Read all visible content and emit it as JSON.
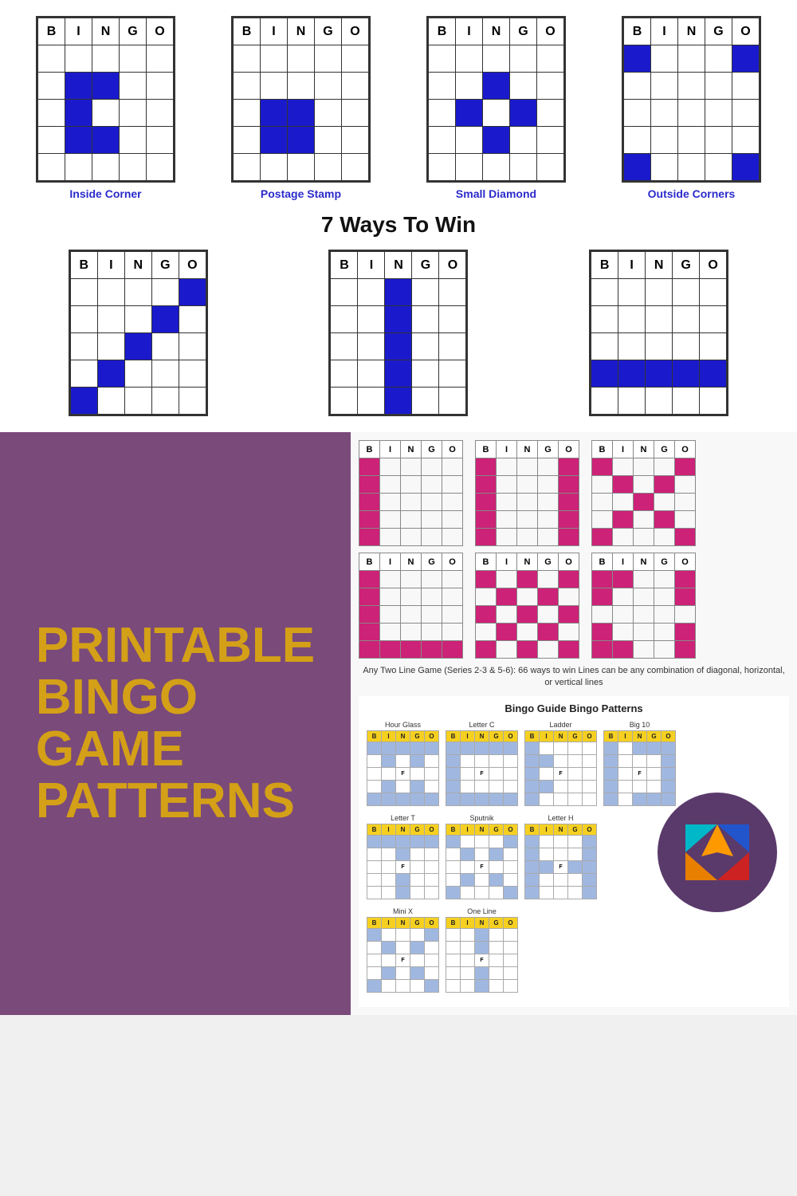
{
  "top": {
    "cards4": [
      {
        "label": "Inside Corner",
        "pattern": [
          [
            0,
            0,
            0,
            0,
            0
          ],
          [
            0,
            1,
            1,
            0,
            0
          ],
          [
            0,
            1,
            0,
            0,
            0
          ],
          [
            0,
            1,
            1,
            0,
            0
          ],
          [
            0,
            0,
            0,
            0,
            0
          ]
        ]
      },
      {
        "label": "Postage Stamp",
        "pattern": [
          [
            0,
            0,
            0,
            0,
            0
          ],
          [
            0,
            0,
            0,
            0,
            0
          ],
          [
            0,
            1,
            1,
            0,
            0
          ],
          [
            0,
            1,
            1,
            0,
            0
          ],
          [
            0,
            0,
            0,
            0,
            0
          ]
        ]
      },
      {
        "label": "Small Diamond",
        "pattern": [
          [
            0,
            0,
            0,
            0,
            0
          ],
          [
            0,
            0,
            1,
            0,
            0
          ],
          [
            0,
            1,
            0,
            1,
            0
          ],
          [
            0,
            0,
            1,
            0,
            0
          ],
          [
            0,
            0,
            0,
            0,
            0
          ]
        ]
      },
      {
        "label": "Outside Corners",
        "pattern": [
          [
            1,
            0,
            0,
            0,
            1
          ],
          [
            0,
            0,
            0,
            0,
            0
          ],
          [
            0,
            0,
            0,
            0,
            0
          ],
          [
            0,
            0,
            0,
            0,
            0
          ],
          [
            1,
            0,
            0,
            0,
            1
          ]
        ]
      }
    ],
    "ways_title": "7 Ways To Win",
    "cards3": [
      {
        "label": "",
        "pattern": [
          [
            0,
            0,
            0,
            0,
            1
          ],
          [
            0,
            0,
            0,
            1,
            0
          ],
          [
            0,
            0,
            1,
            0,
            0
          ],
          [
            0,
            1,
            0,
            0,
            0
          ],
          [
            1,
            0,
            0,
            0,
            0
          ]
        ]
      },
      {
        "label": "",
        "pattern": [
          [
            0,
            0,
            1,
            0,
            0
          ],
          [
            0,
            0,
            1,
            0,
            0
          ],
          [
            0,
            0,
            1,
            0,
            0
          ],
          [
            0,
            0,
            1,
            0,
            0
          ],
          [
            0,
            0,
            1,
            0,
            0
          ]
        ]
      },
      {
        "label": "",
        "pattern": [
          [
            0,
            0,
            0,
            0,
            0
          ],
          [
            0,
            0,
            0,
            0,
            0
          ],
          [
            0,
            0,
            0,
            0,
            0
          ],
          [
            1,
            1,
            1,
            1,
            1
          ],
          [
            0,
            0,
            0,
            0,
            0
          ]
        ]
      }
    ]
  },
  "purple_panel": {
    "text": "PRINTABLE\nBINGO\nGAME\nPATTERNS"
  },
  "right_panel": {
    "pink_rows": [
      {
        "cards": [
          {
            "pattern": [
              [
                1,
                0,
                0,
                0,
                0
              ],
              [
                1,
                0,
                0,
                0,
                0
              ],
              [
                1,
                0,
                0,
                0,
                0
              ],
              [
                1,
                0,
                0,
                0,
                0
              ],
              [
                1,
                0,
                0,
                0,
                0
              ]
            ]
          },
          {
            "pattern": [
              [
                1,
                0,
                0,
                0,
                1
              ],
              [
                1,
                0,
                0,
                0,
                1
              ],
              [
                1,
                0,
                0,
                0,
                1
              ],
              [
                1,
                0,
                0,
                0,
                1
              ],
              [
                1,
                0,
                0,
                0,
                1
              ]
            ]
          },
          {
            "pattern": [
              [
                1,
                0,
                0,
                0,
                1
              ],
              [
                0,
                1,
                0,
                1,
                0
              ],
              [
                0,
                0,
                1,
                0,
                0
              ],
              [
                0,
                1,
                0,
                1,
                0
              ],
              [
                1,
                0,
                0,
                0,
                1
              ]
            ]
          }
        ]
      },
      {
        "cards": [
          {
            "pattern": [
              [
                1,
                0,
                0,
                0,
                0
              ],
              [
                1,
                0,
                0,
                0,
                0
              ],
              [
                1,
                0,
                0,
                0,
                0
              ],
              [
                1,
                0,
                0,
                0,
                0
              ],
              [
                1,
                1,
                1,
                1,
                1
              ]
            ]
          },
          {
            "pattern": [
              [
                1,
                0,
                1,
                0,
                1
              ],
              [
                0,
                1,
                0,
                1,
                0
              ],
              [
                1,
                0,
                1,
                0,
                1
              ],
              [
                0,
                1,
                0,
                1,
                0
              ],
              [
                1,
                0,
                1,
                0,
                1
              ]
            ]
          },
          {
            "pattern": [
              [
                1,
                1,
                0,
                0,
                1
              ],
              [
                1,
                0,
                0,
                0,
                1
              ],
              [
                0,
                0,
                0,
                0,
                0
              ],
              [
                1,
                0,
                0,
                0,
                1
              ],
              [
                1,
                1,
                0,
                0,
                1
              ]
            ]
          }
        ]
      }
    ],
    "any_two_line": "Any Two Line Game (Series 2-3 & 5-6): 66 ways to win\nLines can be any combination of diagonal, horizontal, or vertical lines",
    "guide_title": "Bingo Guide  Bingo Patterns",
    "guide_rows": [
      {
        "cards": [
          {
            "name": "Hour Glass",
            "pattern": [
              [
                1,
                1,
                1,
                1,
                1
              ],
              [
                0,
                1,
                0,
                1,
                0
              ],
              [
                0,
                0,
                0,
                0,
                0
              ],
              [
                0,
                1,
                0,
                1,
                0
              ],
              [
                1,
                1,
                1,
                1,
                1
              ]
            ],
            "special": "F",
            "special_row": 2,
            "special_col": 2
          },
          {
            "name": "Letter C",
            "pattern": [
              [
                1,
                1,
                1,
                1,
                1
              ],
              [
                1,
                0,
                0,
                0,
                0
              ],
              [
                1,
                0,
                0,
                0,
                0
              ],
              [
                1,
                0,
                0,
                0,
                0
              ],
              [
                1,
                1,
                1,
                1,
                1
              ]
            ],
            "special": "F",
            "special_row": 2,
            "special_col": 2
          },
          {
            "name": "Ladder",
            "pattern": [
              [
                1,
                0,
                0,
                0,
                0
              ],
              [
                1,
                1,
                0,
                0,
                0
              ],
              [
                1,
                0,
                0,
                0,
                0
              ],
              [
                1,
                1,
                0,
                0,
                0
              ],
              [
                1,
                0,
                0,
                0,
                0
              ]
            ],
            "special": "F",
            "special_row": 2,
            "special_col": 2
          },
          {
            "name": "Big 10",
            "pattern": [
              [
                1,
                0,
                1,
                1,
                1
              ],
              [
                1,
                0,
                0,
                0,
                1
              ],
              [
                1,
                0,
                0,
                0,
                1
              ],
              [
                1,
                0,
                0,
                0,
                1
              ],
              [
                1,
                0,
                1,
                1,
                1
              ]
            ],
            "special": "F",
            "special_row": 2,
            "special_col": 2
          }
        ]
      },
      {
        "cards": [
          {
            "name": "Letter T",
            "pattern": [
              [
                1,
                1,
                1,
                1,
                1
              ],
              [
                0,
                0,
                1,
                0,
                0
              ],
              [
                0,
                0,
                1,
                0,
                0
              ],
              [
                0,
                0,
                1,
                0,
                0
              ],
              [
                0,
                0,
                1,
                0,
                0
              ]
            ],
            "special": "F",
            "special_row": 2,
            "special_col": 2
          },
          {
            "name": "Sputnik",
            "pattern": [
              [
                1,
                0,
                0,
                0,
                1
              ],
              [
                0,
                1,
                0,
                1,
                0
              ],
              [
                0,
                0,
                1,
                0,
                0
              ],
              [
                0,
                1,
                0,
                1,
                0
              ],
              [
                1,
                0,
                0,
                0,
                1
              ]
            ],
            "special": "F",
            "special_row": 2,
            "special_col": 2
          },
          {
            "name": "Letter H",
            "pattern": [
              [
                1,
                0,
                0,
                0,
                1
              ],
              [
                1,
                0,
                0,
                0,
                1
              ],
              [
                1,
                1,
                1,
                1,
                1
              ],
              [
                1,
                0,
                0,
                0,
                1
              ],
              [
                1,
                0,
                0,
                0,
                1
              ]
            ],
            "special": "F",
            "special_row": 2,
            "special_col": 2
          }
        ]
      },
      {
        "cards": [
          {
            "name": "Mini X",
            "pattern": [
              [
                1,
                0,
                0,
                0,
                1
              ],
              [
                0,
                1,
                0,
                1,
                0
              ],
              [
                0,
                0,
                1,
                0,
                0
              ],
              [
                0,
                1,
                0,
                1,
                0
              ],
              [
                1,
                0,
                0,
                0,
                1
              ]
            ],
            "special": "F",
            "special_row": 2,
            "special_col": 2
          },
          {
            "name": "One Line",
            "pattern": [
              [
                0,
                0,
                1,
                0,
                0
              ],
              [
                0,
                0,
                1,
                0,
                0
              ],
              [
                0,
                0,
                1,
                0,
                0
              ],
              [
                0,
                0,
                1,
                0,
                0
              ],
              [
                0,
                0,
                1,
                0,
                0
              ]
            ],
            "special": "F",
            "special_row": 2,
            "special_col": 2
          }
        ]
      }
    ]
  }
}
